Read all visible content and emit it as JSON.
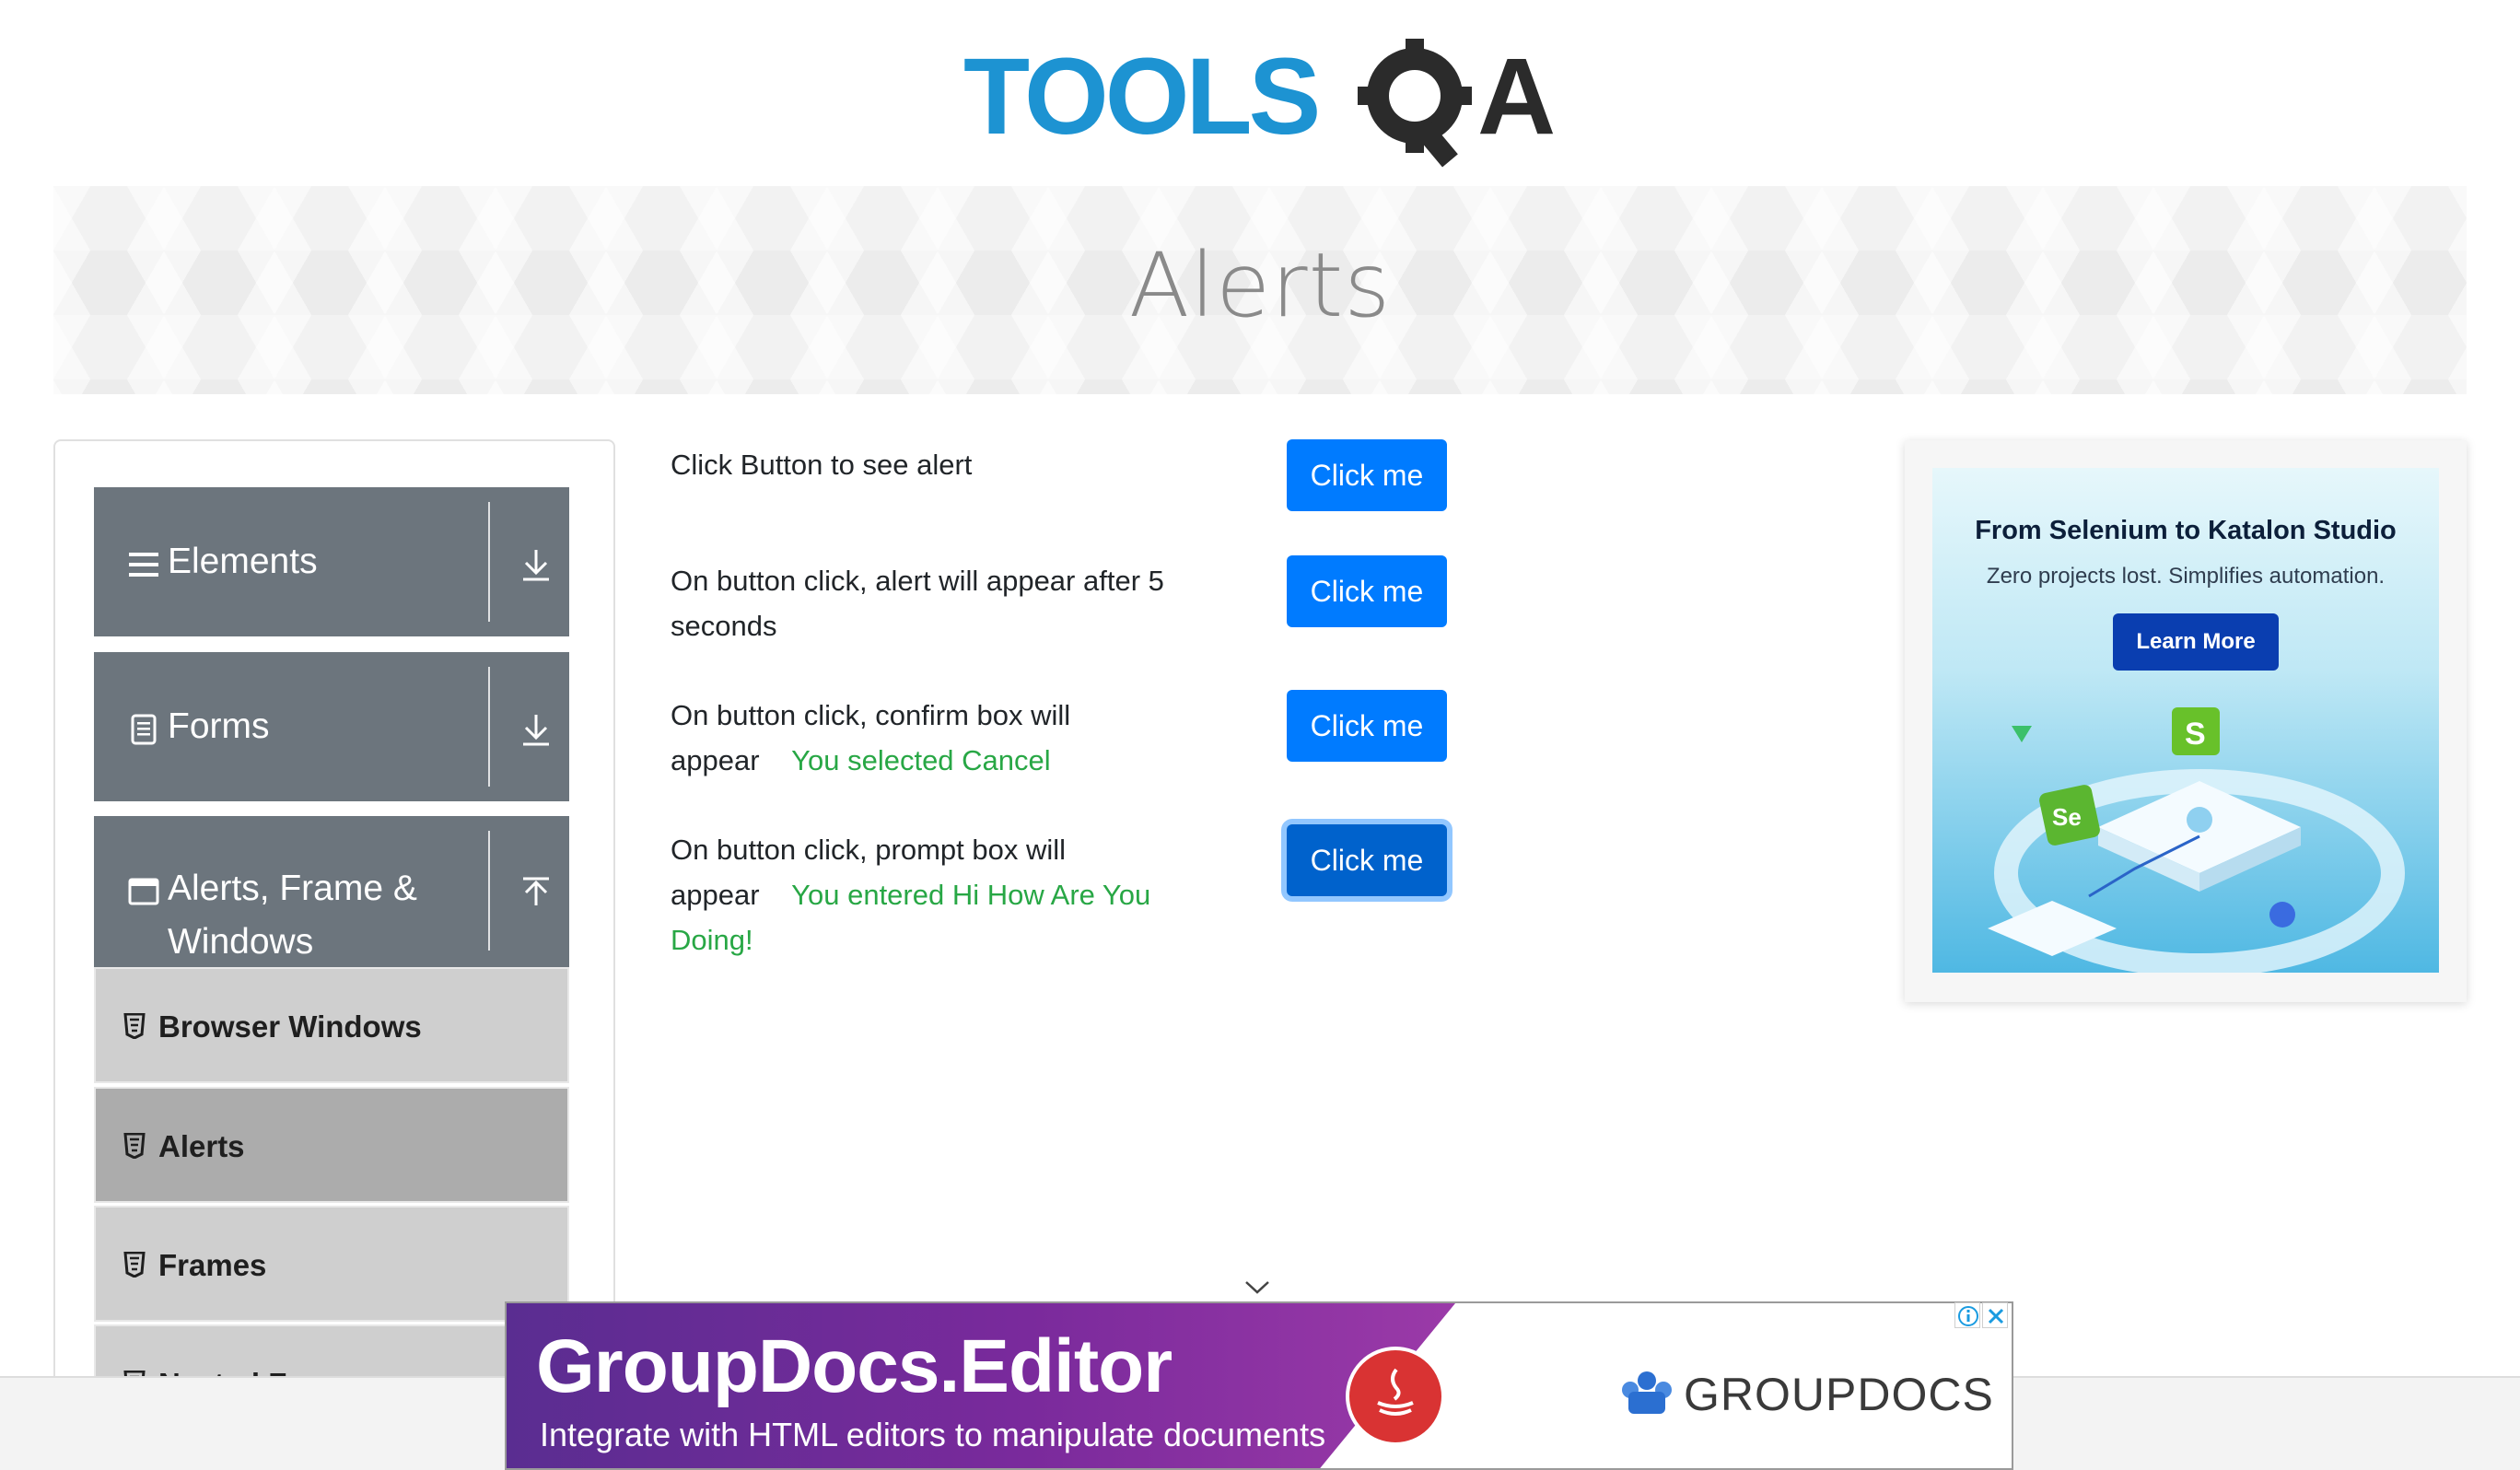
{
  "header": {
    "logo_text_part1": "TOOLS",
    "logo_text_part2": "QA",
    "banner_title": "Alerts"
  },
  "sidebar": {
    "groups": [
      {
        "label": "Elements",
        "icon": "hamburger-icon",
        "arrow": "download-arrow-icon"
      },
      {
        "label": "Forms",
        "icon": "document-icon",
        "arrow": "download-arrow-icon"
      },
      {
        "label_line1": "Alerts, Frame &",
        "label_line2": "Windows",
        "icon": "window-icon",
        "arrow": "upload-arrow-icon"
      }
    ],
    "items": [
      {
        "label": "Browser Windows",
        "icon": "html5-icon",
        "active": false
      },
      {
        "label": "Alerts",
        "icon": "html5-icon",
        "active": true
      },
      {
        "label": "Frames",
        "icon": "html5-icon",
        "active": false
      },
      {
        "label": "Nested Frames",
        "icon": "html5-icon",
        "active": false
      }
    ]
  },
  "main": {
    "rows": [
      {
        "text": "Click Button to see alert",
        "result": "",
        "button": "Click me"
      },
      {
        "text_line1": "On button click, alert will appear after 5",
        "text_line2": "seconds",
        "result": "",
        "button": "Click me"
      },
      {
        "text_line1": "On button click, confirm box will",
        "text_line2": "appear",
        "result": "You selected Cancel",
        "button": "Click me"
      },
      {
        "text_line1": "On button click, prompt box will",
        "text_line2": "appear",
        "result_line1": "You entered Hi How Are You",
        "result_line2": "Doing!",
        "button": "Click me"
      }
    ],
    "result_color": "#28a745",
    "button_color": "#007bff"
  },
  "ad_right": {
    "title": "From Selenium to Katalon Studio",
    "subtitle": "Zero projects lost. Simplifies automation.",
    "cta": "Learn More",
    "badge_selenium": "Se",
    "badge_katalon": "S"
  },
  "ad_bottom": {
    "title": "GroupDocs.Editor",
    "subtitle": "Integrate with HTML editors to manipulate documents",
    "brand": "GROUPDOCS"
  }
}
